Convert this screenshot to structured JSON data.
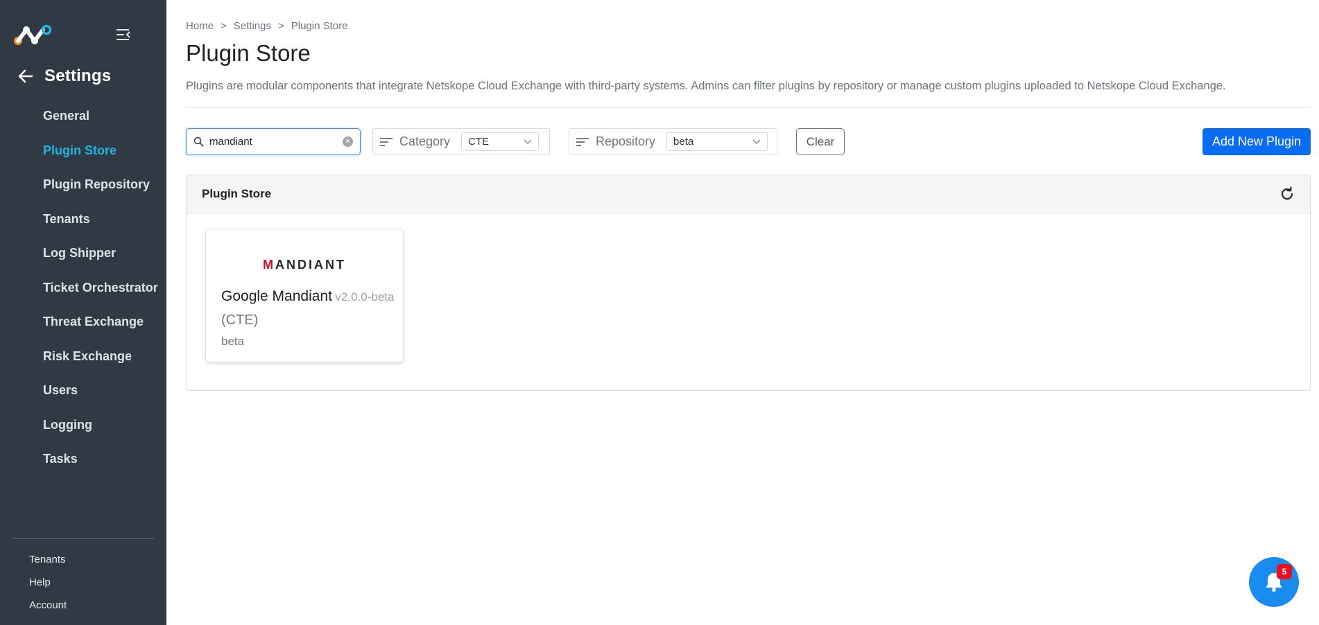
{
  "sidebar": {
    "section_title": "Settings",
    "items": [
      {
        "label": "General"
      },
      {
        "label": "Plugin Store"
      },
      {
        "label": "Plugin Repository"
      },
      {
        "label": "Tenants"
      },
      {
        "label": "Log Shipper"
      },
      {
        "label": "Ticket Orchestrator"
      },
      {
        "label": "Threat Exchange"
      },
      {
        "label": "Risk Exchange"
      },
      {
        "label": "Users"
      },
      {
        "label": "Logging"
      },
      {
        "label": "Tasks"
      }
    ],
    "active_item": "Plugin Store",
    "footer_links": [
      {
        "label": "Tenants"
      },
      {
        "label": "Help"
      },
      {
        "label": "Account"
      }
    ]
  },
  "breadcrumb": [
    "Home",
    "Settings",
    "Plugin Store"
  ],
  "breadcrumb_separator": ">",
  "page": {
    "title": "Plugin Store",
    "description": "Plugins are modular components that integrate Netskope Cloud Exchange with third-party systems. Admins can filter plugins by repository or manage custom plugins uploaded to Netskope Cloud Exchange."
  },
  "filters": {
    "search_value": "mandiant",
    "category_label": "Category",
    "category_value": "CTE",
    "repository_label": "Repository",
    "repository_value": "beta",
    "clear_label": "Clear",
    "add_label": "Add New Plugin"
  },
  "panel": {
    "title": "Plugin Store",
    "cards": [
      {
        "logo_text_first": "M",
        "logo_text_rest": "ANDIANT",
        "name": "Google Mandiant",
        "version": "v2.0.0-beta",
        "category": "(CTE)",
        "repository": "beta"
      }
    ]
  },
  "notifications": {
    "count": "5"
  },
  "colors": {
    "sidebar_bg": "#2f3a44",
    "active_nav": "#1fb6e0",
    "primary_button": "#0a6cf0",
    "badge": "#e8101e",
    "logo_orange": "#f7931e",
    "logo_blue": "#1fb6e0"
  }
}
